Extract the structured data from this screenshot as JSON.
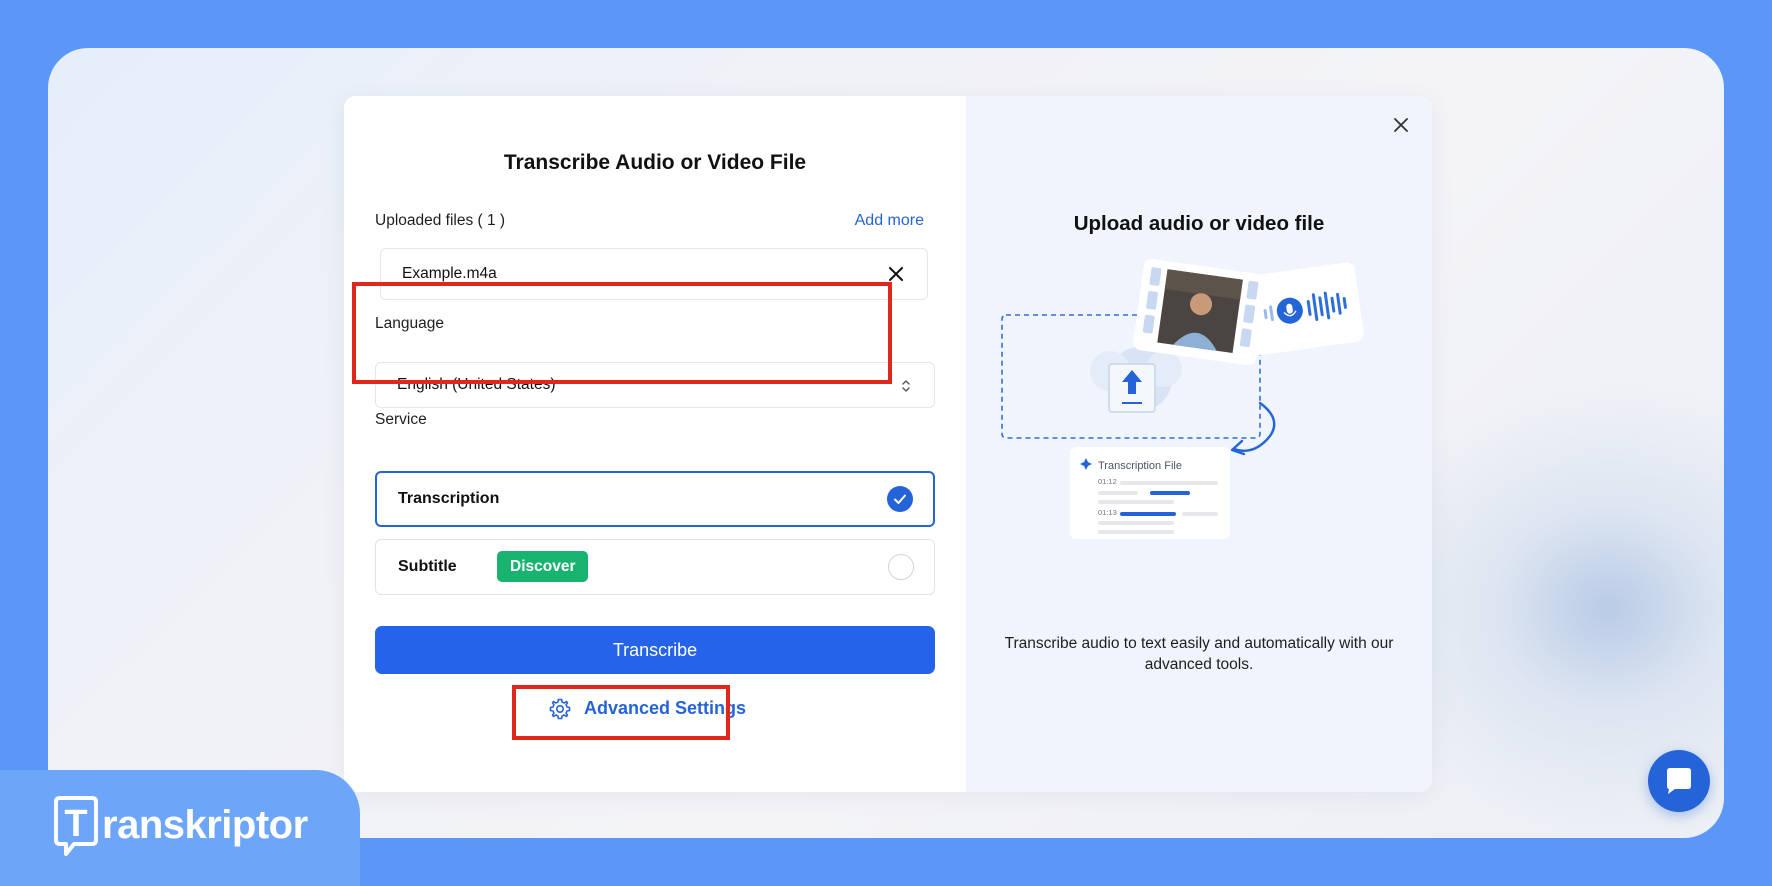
{
  "modal": {
    "title": "Transcribe Audio or Video File",
    "uploaded_label": "Uploaded files ( 1 )",
    "add_more": "Add more",
    "file_name": "Example.m4a",
    "language_label": "Language",
    "language_value": "English (United States)",
    "service_label": "Service",
    "services": [
      {
        "label": "Transcription",
        "selected": true
      },
      {
        "label": "Subtitle",
        "badge": "Discover",
        "selected": false
      }
    ],
    "transcribe_button": "Transcribe",
    "advanced_settings": "Advanced Settings"
  },
  "panel": {
    "title": "Upload audio or video file",
    "illustration": {
      "card_title": "Transcription File",
      "times": [
        "01:12",
        "01:13"
      ]
    },
    "description": "Transcribe audio to text easily and automatically with our advanced tools."
  },
  "brand": {
    "name": "ranskriptor",
    "logo_letter": "T"
  },
  "colors": {
    "accent": "#2563d8",
    "badge": "#17b36f",
    "highlight": "#e1261c",
    "background": "#5a97f7"
  },
  "icons": {
    "close": "close-icon",
    "remove_file": "x-icon",
    "select": "chevron-updown-icon",
    "check": "check-icon",
    "settings": "gear-icon",
    "chat": "chat-icon"
  }
}
